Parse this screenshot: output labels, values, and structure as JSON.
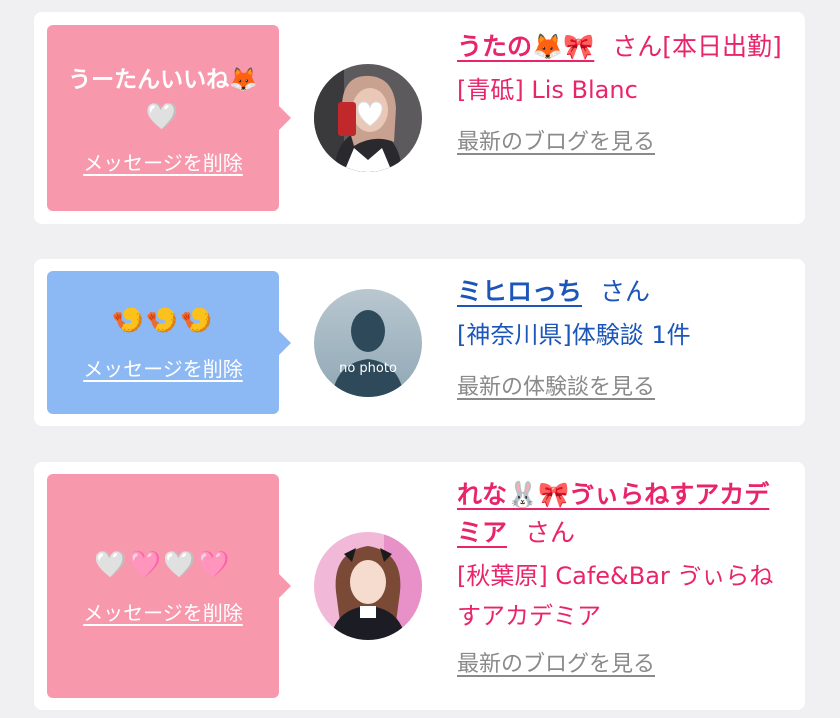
{
  "cards": [
    {
      "message_line1": "うーたんいいね🦊",
      "message_line2": "🤍",
      "delete_label": "メッセージを削除",
      "name": "うたの🦊🎀",
      "honorific": "さん",
      "status": "[本日出勤]",
      "shop": "[青砥] Lis Blanc",
      "link_label": "最新のブログを見る",
      "bubble_color": "#f898ac",
      "name_color": "#e8256a"
    },
    {
      "message_line1": "🍤🍤🍤",
      "delete_label": "メッセージを削除",
      "name": "ミヒロっち",
      "honorific": "さん",
      "shop": "[神奈川県]体験談 1件",
      "link_label": "最新の体験談を見る",
      "avatar_text": "no photo",
      "bubble_color": "#8cb8f4",
      "name_color": "#1b56b8"
    },
    {
      "message_line1": "🤍🩷🤍🩷",
      "delete_label": "メッセージを削除",
      "name": "れな🐰🎀ゔぃらねすアカデミア",
      "honorific": "さん",
      "shop": "[秋葉原] Cafe&Bar ゔぃらねすアカデミア",
      "link_label": "最新のブログを見る",
      "bubble_color": "#f898ac",
      "name_color": "#e8256a"
    }
  ]
}
